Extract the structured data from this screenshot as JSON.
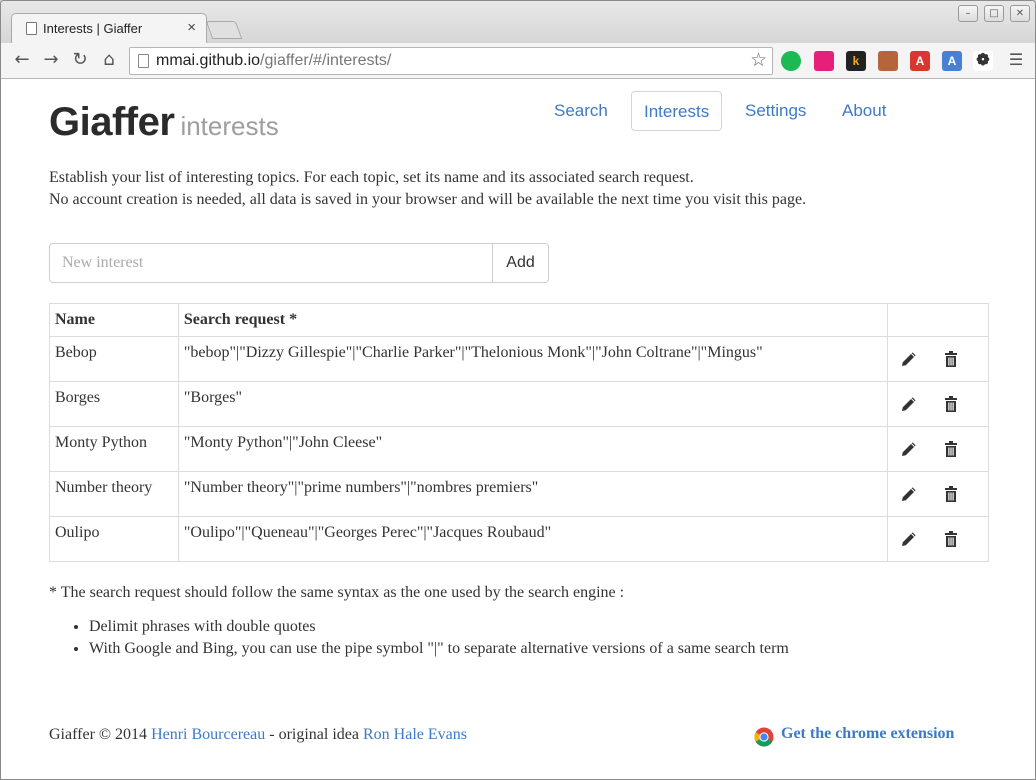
{
  "browser": {
    "tab_title": "Interests | Giaffer",
    "tab_close": "×",
    "url_host": "mmai.github.io",
    "url_path": "/giaffer/#/interests/"
  },
  "header": {
    "brand": "Giaffer",
    "subtitle": "interests",
    "nav": [
      {
        "label": "Search"
      },
      {
        "label": "Interests",
        "active": true
      },
      {
        "label": "Settings"
      },
      {
        "label": "About"
      }
    ]
  },
  "intro": {
    "line1": "Establish your list of interesting topics. For each topic, set its name and its associated search request.",
    "line2": "No account creation is needed, all data is saved in your browser and will be available the next time you visit this page."
  },
  "add_form": {
    "placeholder": "New interest",
    "button_label": "Add"
  },
  "table": {
    "headers": [
      "Name",
      "Search request *",
      ""
    ],
    "rows": [
      {
        "name": "Bebop",
        "request": "\"bebop\"|\"Dizzy Gillespie\"|\"Charlie Parker\"|\"Thelonious Monk\"|\"John Coltrane\"|\"Mingus\""
      },
      {
        "name": "Borges",
        "request": "\"Borges\""
      },
      {
        "name": "Monty Python",
        "request": "\"Monty Python\"|\"John Cleese\""
      },
      {
        "name": "Number theory",
        "request": "\"Number theory\"|\"prime numbers\"|\"nombres premiers\""
      },
      {
        "name": "Oulipo",
        "request": "\"Oulipo\"|\"Queneau\"|\"Georges Perec\"|\"Jacques Roubaud\""
      }
    ],
    "row_icons": [
      "pencil-icon",
      "trash-icon"
    ]
  },
  "notes": {
    "footnote": "* The search request should follow the same syntax as the one used by the search engine :",
    "rules": [
      "Delimit phrases with double quotes",
      "With Google and Bing, you can use the pipe symbol \"|\" to separate alternative versions of a same search term"
    ]
  },
  "footer": {
    "prefix": "Giaffer © 2014 ",
    "author": "Henri Bourcereau",
    "middle": " - original idea ",
    "idea_author": "Ron Hale Evans",
    "extension_link": "Get the chrome extension"
  },
  "colors": {
    "link": "#3d7ac6",
    "text": "#333333",
    "muted": "#9e9e9e"
  }
}
